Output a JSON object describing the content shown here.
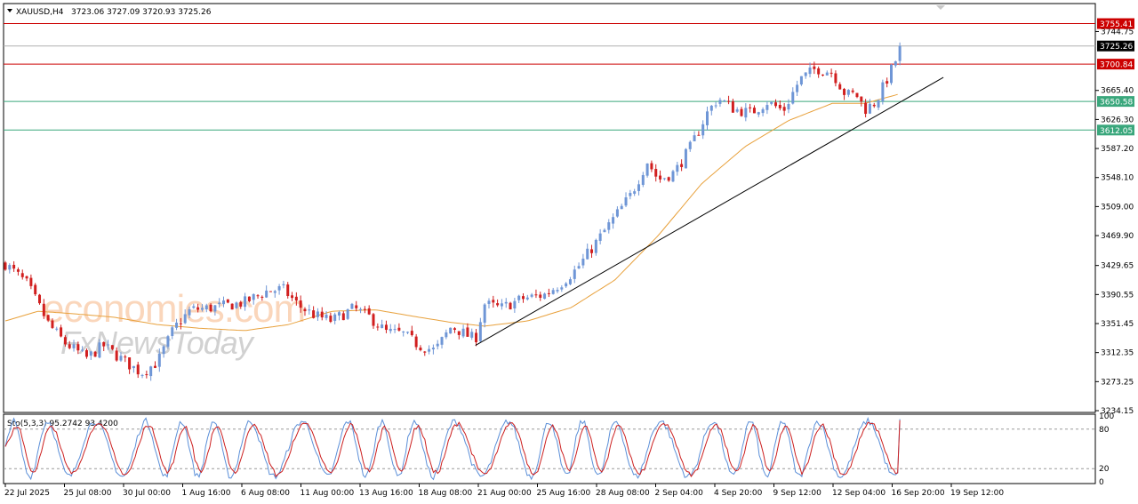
{
  "header": {
    "symbol": "XAUUSD,H4",
    "ohlc": "3723.06 3727.09 3720.93 3725.26"
  },
  "osc_header": "Sto(5,3,3) 95.2742 93.4200",
  "watermark": {
    "line1": "economies.com",
    "line2": "FxNewsToday"
  },
  "colors": {
    "bull": "#6f96d6",
    "bear": "#d11f1f",
    "ma": "#e8a13c",
    "support": "#3aa77c",
    "resistance": "#cc0000",
    "trend": "#000000",
    "sto_main": "#5b8fd8",
    "sto_signal": "#cc1f1f",
    "current_tag_bg": "#000000"
  },
  "chart_data": {
    "type": "candlestick",
    "symbol": "XAUUSD",
    "timeframe": "H4",
    "ylim": [
      3234.15,
      3780
    ],
    "y_ticks": [
      "3744.75",
      "3665.40",
      "3626.30",
      "3587.20",
      "3548.10",
      "3509.00",
      "3469.90",
      "3429.65",
      "3390.55",
      "3351.45",
      "3312.35",
      "3273.25",
      "3234.15"
    ],
    "x_ticks": [
      "22 Jul 2025",
      "25 Jul 08:00",
      "30 Jul 00:00",
      "1 Aug 16:00",
      "6 Aug 08:00",
      "11 Aug 00:00",
      "13 Aug 16:00",
      "18 Aug 08:00",
      "21 Aug 00:00",
      "25 Aug 16:00",
      "28 Aug 08:00",
      "2 Sep 04:00",
      "4 Sep 20:00",
      "9 Sep 12:00",
      "12 Sep 04:00",
      "16 Sep 20:00",
      "19 Sep 12:00"
    ],
    "levels": [
      {
        "value": 3755.41,
        "label": "3755.41",
        "kind": "resistance"
      },
      {
        "value": 3725.26,
        "label": "3725.26",
        "kind": "current"
      },
      {
        "value": 3700.84,
        "label": "3700.84",
        "kind": "resistance"
      },
      {
        "value": 3650.58,
        "label": "3650.58",
        "kind": "support"
      },
      {
        "value": 3612.05,
        "label": "3612.05",
        "kind": "support"
      }
    ],
    "trendline": {
      "from": [
        0.432,
        3322
      ],
      "to": [
        0.862,
        3683
      ]
    },
    "price_path": [
      [
        0,
        3432
      ],
      [
        0.02,
        3405
      ],
      [
        0.04,
        3350
      ],
      [
        0.055,
        3325
      ],
      [
        0.075,
        3305
      ],
      [
        0.09,
        3322
      ],
      [
        0.11,
        3300
      ],
      [
        0.125,
        3285
      ],
      [
        0.14,
        3300
      ],
      [
        0.155,
        3345
      ],
      [
        0.17,
        3370
      ],
      [
        0.185,
        3372
      ],
      [
        0.2,
        3375
      ],
      [
        0.22,
        3380
      ],
      [
        0.24,
        3395
      ],
      [
        0.255,
        3398
      ],
      [
        0.27,
        3375
      ],
      [
        0.285,
        3362
      ],
      [
        0.3,
        3355
      ],
      [
        0.32,
        3372
      ],
      [
        0.335,
        3360
      ],
      [
        0.35,
        3340
      ],
      [
        0.365,
        3338
      ],
      [
        0.38,
        3322
      ],
      [
        0.395,
        3315
      ],
      [
        0.41,
        3348
      ],
      [
        0.425,
        3335
      ],
      [
        0.432,
        3330
      ],
      [
        0.44,
        3378
      ],
      [
        0.455,
        3372
      ],
      [
        0.475,
        3385
      ],
      [
        0.495,
        3390
      ],
      [
        0.51,
        3405
      ],
      [
        0.525,
        3425
      ],
      [
        0.545,
        3465
      ],
      [
        0.56,
        3495
      ],
      [
        0.575,
        3525
      ],
      [
        0.59,
        3570
      ],
      [
        0.6,
        3545
      ],
      [
        0.615,
        3555
      ],
      [
        0.63,
        3590
      ],
      [
        0.645,
        3635
      ],
      [
        0.655,
        3655
      ],
      [
        0.67,
        3640
      ],
      [
        0.685,
        3635
      ],
      [
        0.7,
        3650
      ],
      [
        0.715,
        3638
      ],
      [
        0.73,
        3680
      ],
      [
        0.745,
        3695
      ],
      [
        0.76,
        3690
      ],
      [
        0.772,
        3660
      ],
      [
        0.782,
        3660
      ],
      [
        0.79,
        3640
      ],
      [
        0.8,
        3650
      ],
      [
        0.81,
        3680
      ],
      [
        0.818,
        3705
      ],
      [
        0.822,
        3725
      ]
    ],
    "ma_path": [
      [
        0,
        3355
      ],
      [
        0.03,
        3368
      ],
      [
        0.06,
        3365
      ],
      [
        0.1,
        3360
      ],
      [
        0.14,
        3350
      ],
      [
        0.18,
        3345
      ],
      [
        0.22,
        3342
      ],
      [
        0.26,
        3350
      ],
      [
        0.3,
        3368
      ],
      [
        0.34,
        3370
      ],
      [
        0.38,
        3360
      ],
      [
        0.41,
        3353
      ],
      [
        0.44,
        3348
      ],
      [
        0.48,
        3355
      ],
      [
        0.52,
        3373
      ],
      [
        0.56,
        3410
      ],
      [
        0.6,
        3470
      ],
      [
        0.64,
        3540
      ],
      [
        0.68,
        3590
      ],
      [
        0.72,
        3625
      ],
      [
        0.76,
        3648
      ],
      [
        0.79,
        3648
      ],
      [
        0.82,
        3660
      ]
    ],
    "oscillator": {
      "name": "Sto(5,3,3)",
      "main": 95.2742,
      "signal": 93.42,
      "ylim": [
        0,
        100
      ],
      "levels": [
        80,
        20
      ],
      "tick_labels": [
        "100",
        "80",
        "20",
        "0"
      ]
    }
  }
}
